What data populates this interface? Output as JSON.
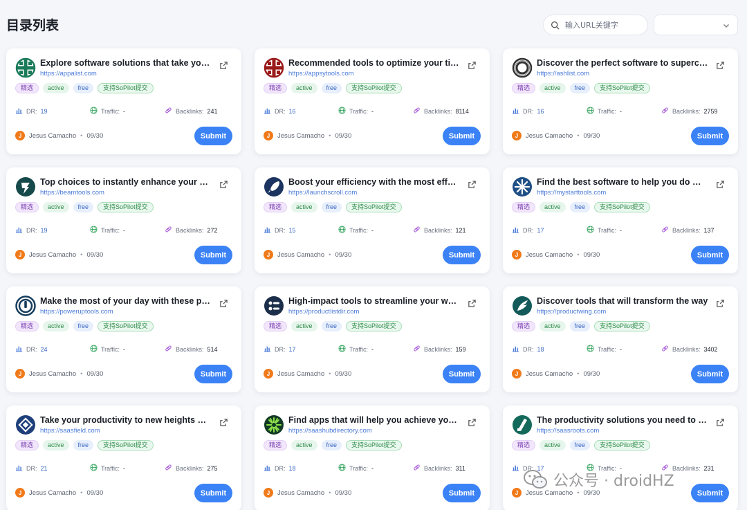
{
  "page": {
    "title": "目录列表",
    "search_placeholder": "输入URL关键字",
    "filter_value": ""
  },
  "tags": {
    "featured": "精选",
    "active": "active",
    "free": "free",
    "sopilot": "支持SoPilot提交"
  },
  "labels": {
    "dr": "DR:",
    "traffic": "Traffic:",
    "backlinks": "Backlinks:",
    "dot": "•",
    "submit": "Submit"
  },
  "cards": [
    {
      "title": "Explore software solutions that take your productivity",
      "url": "https://appalist.com",
      "dr": "19",
      "traffic": "-",
      "backlinks": "241",
      "author": "Jesus Camacho",
      "avatar_letter": "J",
      "date": "09/30",
      "logo": "cross-grid",
      "color": "#1a7a5a"
    },
    {
      "title": "Recommended tools to optimize your time",
      "url": "https://appsytools.com",
      "dr": "16",
      "traffic": "-",
      "backlinks": "8114",
      "author": "Jesus Camacho",
      "avatar_letter": "J",
      "date": "09/30",
      "logo": "cross-grid",
      "color": "#9b1b1b"
    },
    {
      "title": "Discover the perfect software to supercharge",
      "url": "https://ashlist.com",
      "dr": "16",
      "traffic": "-",
      "backlinks": "2759",
      "author": "Jesus Camacho",
      "avatar_letter": "J",
      "date": "09/30",
      "logo": "ring",
      "color": "#333333"
    },
    {
      "title": "Top choices to instantly enhance your productivity",
      "url": "https://beamtools.com",
      "dr": "19",
      "traffic": "-",
      "backlinks": "272",
      "author": "Jesus Camacho",
      "avatar_letter": "J",
      "date": "09/30",
      "logo": "bolt-circle",
      "color": "#164a4a"
    },
    {
      "title": "Boost your efficiency with the most effective",
      "url": "https://launchscroll.com",
      "dr": "15",
      "traffic": "-",
      "backlinks": "121",
      "author": "Jesus Camacho",
      "avatar_letter": "J",
      "date": "09/30",
      "logo": "rocket-circle",
      "color": "#1c3560"
    },
    {
      "title": "Find the best software to help you do more",
      "url": "https://mystarttools.com",
      "dr": "17",
      "traffic": "-",
      "backlinks": "137",
      "author": "Jesus Camacho",
      "avatar_letter": "J",
      "date": "09/30",
      "logo": "snowflake-circle",
      "color": "#1f4f86"
    },
    {
      "title": "Make the most of your day with these practical",
      "url": "https://poweruptools.com",
      "dr": "24",
      "traffic": "-",
      "backlinks": "514",
      "author": "Jesus Camacho",
      "avatar_letter": "J",
      "date": "09/30",
      "logo": "power-circle",
      "color": "#163d5c"
    },
    {
      "title": "High-impact tools to streamline your workflow",
      "url": "https://productlistdir.com",
      "dr": "17",
      "traffic": "-",
      "backlinks": "159",
      "author": "Jesus Camacho",
      "avatar_letter": "J",
      "date": "09/30",
      "logo": "list-circle",
      "color": "#1c2f4a"
    },
    {
      "title": "Discover tools that will transform the way",
      "url": "https://productwing.com",
      "dr": "18",
      "traffic": "-",
      "backlinks": "3402",
      "author": "Jesus Camacho",
      "avatar_letter": "J",
      "date": "09/30",
      "logo": "wing-circle",
      "color": "#145a5a"
    },
    {
      "title": "Take your productivity to new heights with",
      "url": "https://saasfield.com",
      "dr": "21",
      "traffic": "-",
      "backlinks": "275",
      "author": "Jesus Camacho",
      "avatar_letter": "J",
      "date": "09/30",
      "logo": "diamond-circle",
      "color": "#1e3f7a"
    },
    {
      "title": "Find apps that will help you achieve your goals",
      "url": "https://saashubdirectory.com",
      "dr": "18",
      "traffic": "-",
      "backlinks": "311",
      "author": "Jesus Camacho",
      "avatar_letter": "J",
      "date": "09/30",
      "logo": "burst-circle",
      "color": "#123a24"
    },
    {
      "title": "The productivity solutions you need to grow",
      "url": "https://saasroots.com",
      "dr": "17",
      "traffic": "-",
      "backlinks": "231",
      "author": "Jesus Camacho",
      "avatar_letter": "J",
      "date": "09/30",
      "logo": "slash-circle",
      "color": "#136a5a"
    }
  ],
  "watermark": {
    "text": "公众号 · droidHZ",
    "icon": "wechat-icon"
  }
}
